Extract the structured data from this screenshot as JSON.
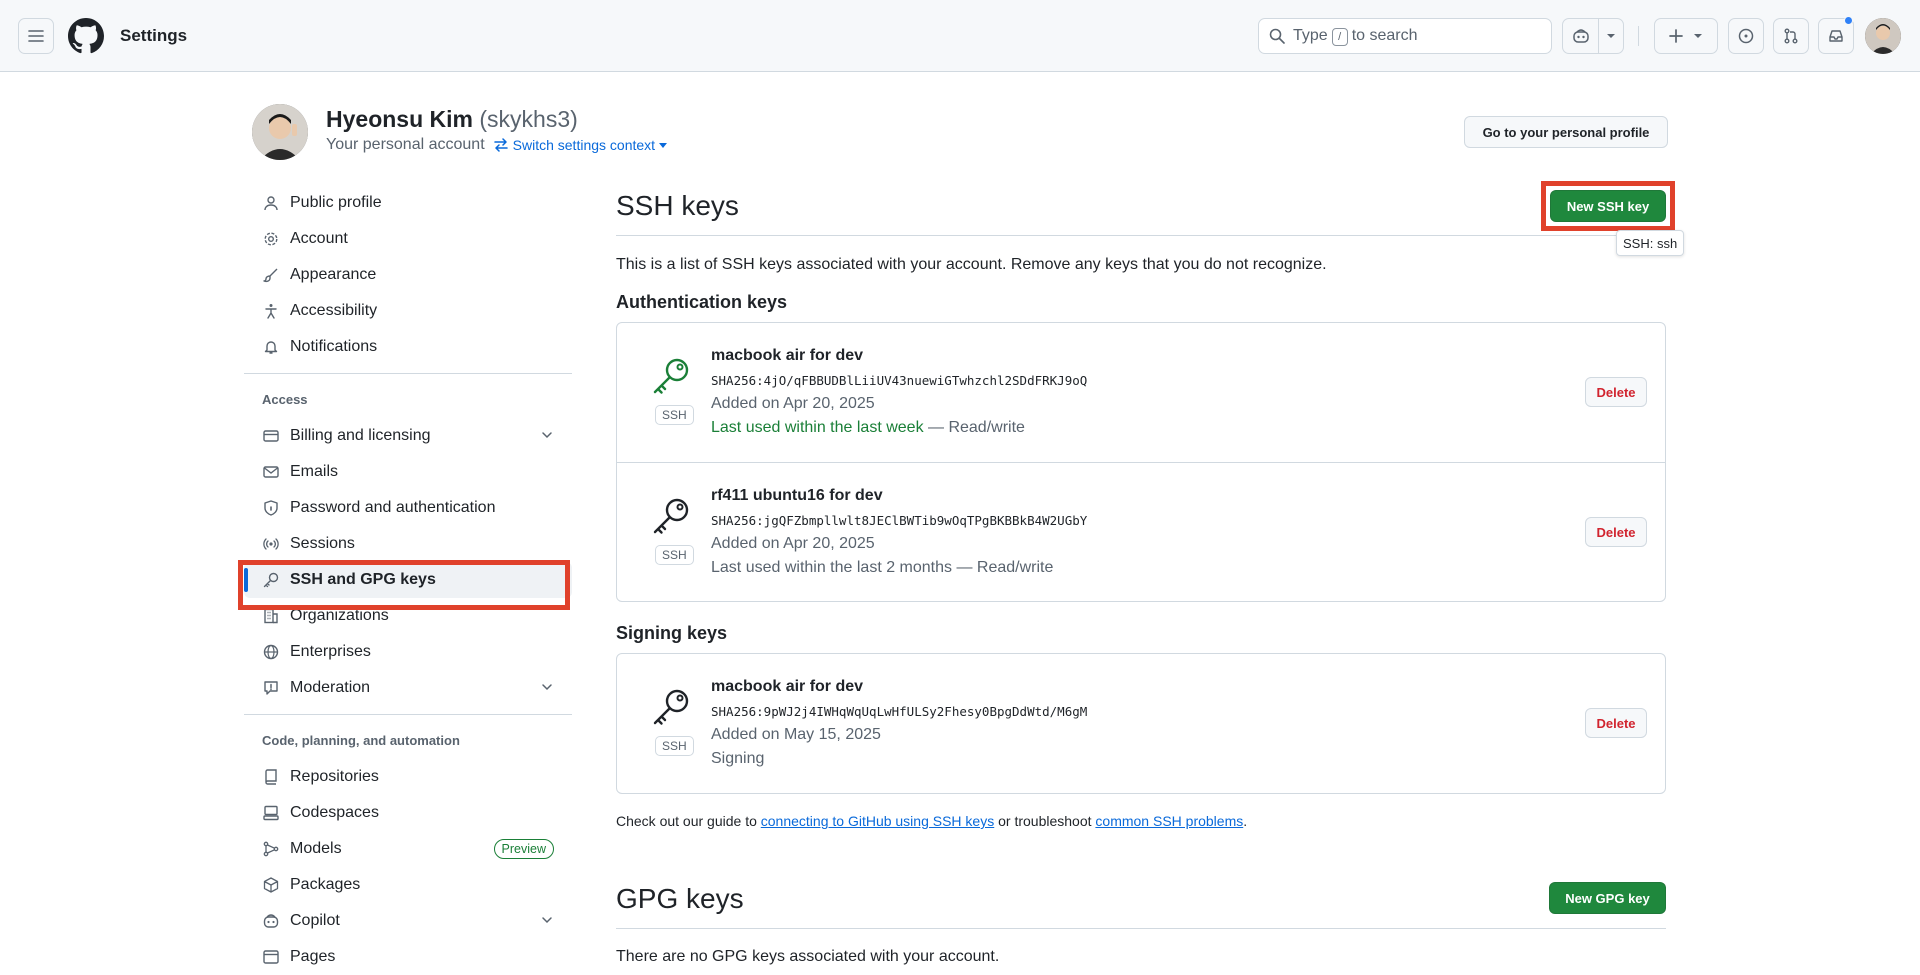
{
  "header": {
    "context_title": "Settings",
    "search_prefix": "Type",
    "search_key": "/",
    "search_suffix": "to search"
  },
  "profile": {
    "name": "Hyeonsu Kim",
    "login": "(skykhs3)",
    "subtitle": "Your personal account",
    "switch_label": "Switch settings context",
    "go_profile_label": "Go to your personal profile"
  },
  "sidebar": {
    "top_items": [
      {
        "label": "Public profile",
        "icon": "person-icon"
      },
      {
        "label": "Account",
        "icon": "gear-icon"
      },
      {
        "label": "Appearance",
        "icon": "paintbrush-icon"
      },
      {
        "label": "Accessibility",
        "icon": "accessibility-icon"
      },
      {
        "label": "Notifications",
        "icon": "bell-icon"
      }
    ],
    "access_heading": "Access",
    "access_items": [
      {
        "label": "Billing and licensing",
        "icon": "credit-card-icon",
        "expandable": true
      },
      {
        "label": "Emails",
        "icon": "mail-icon"
      },
      {
        "label": "Password and authentication",
        "icon": "shield-lock-icon"
      },
      {
        "label": "Sessions",
        "icon": "broadcast-icon"
      },
      {
        "label": "SSH and GPG keys",
        "icon": "key-icon",
        "active": true
      },
      {
        "label": "Organizations",
        "icon": "organization-icon"
      },
      {
        "label": "Enterprises",
        "icon": "globe-icon"
      },
      {
        "label": "Moderation",
        "icon": "report-icon",
        "expandable": true
      }
    ],
    "code_heading": "Code, planning, and automation",
    "code_items": [
      {
        "label": "Repositories",
        "icon": "repo-icon"
      },
      {
        "label": "Codespaces",
        "icon": "codespaces-icon"
      },
      {
        "label": "Models",
        "icon": "models-icon",
        "badge": "Preview"
      },
      {
        "label": "Packages",
        "icon": "package-icon"
      },
      {
        "label": "Copilot",
        "icon": "copilot-icon",
        "expandable": true
      },
      {
        "label": "Pages",
        "icon": "browser-icon"
      }
    ]
  },
  "ssh": {
    "title": "SSH keys",
    "new_button": "New SSH key",
    "tooltip": "SSH: ssh",
    "description": "This is a list of SSH keys associated with your account. Remove any keys that you do not recognize.",
    "auth_heading": "Authentication keys",
    "auth_keys": [
      {
        "title": "macbook air for dev",
        "fingerprint": "SHA256:4jO/qFBBUDBlLiiUV43nuewiGTwhzchl2SDdFRKJ9oQ",
        "added": "Added on Apr 20, 2025",
        "used_green": "Last used within the last week",
        "used_rest": " — Read/write",
        "type": "SSH",
        "delete": "Delete"
      },
      {
        "title": "rf411 ubuntu16 for dev",
        "fingerprint": "SHA256:jgQFZbmpllwlt8JEClBWTib9wOqTPgBKBBkB4W2UGbY",
        "added": "Added on Apr 20, 2025",
        "used_green": "",
        "used_rest": "Last used within the last 2 months — Read/write",
        "type": "SSH",
        "delete": "Delete"
      }
    ],
    "signing_heading": "Signing keys",
    "signing_keys": [
      {
        "title": "macbook air for dev",
        "fingerprint": "SHA256:9pWJ2j4IWHqWqUqLwHfULSy2Fhesy0BpgDdWtd/M6gM",
        "added": "Added on May 15, 2025",
        "used_rest": "Signing",
        "type": "SSH",
        "delete": "Delete"
      }
    ],
    "guide_prefix": "Check out our guide to ",
    "guide_link1": "connecting to GitHub using SSH keys",
    "guide_middle": " or troubleshoot ",
    "guide_link2": "common SSH problems",
    "guide_suffix": "."
  },
  "gpg": {
    "title": "GPG keys",
    "new_button": "New GPG key",
    "empty": "There are no GPG keys associated with your account."
  },
  "colors": {
    "accent_blue": "#0969da",
    "primary_green": "#1f883d",
    "danger_red": "#d1242f",
    "highlight_red": "#e0412b"
  }
}
